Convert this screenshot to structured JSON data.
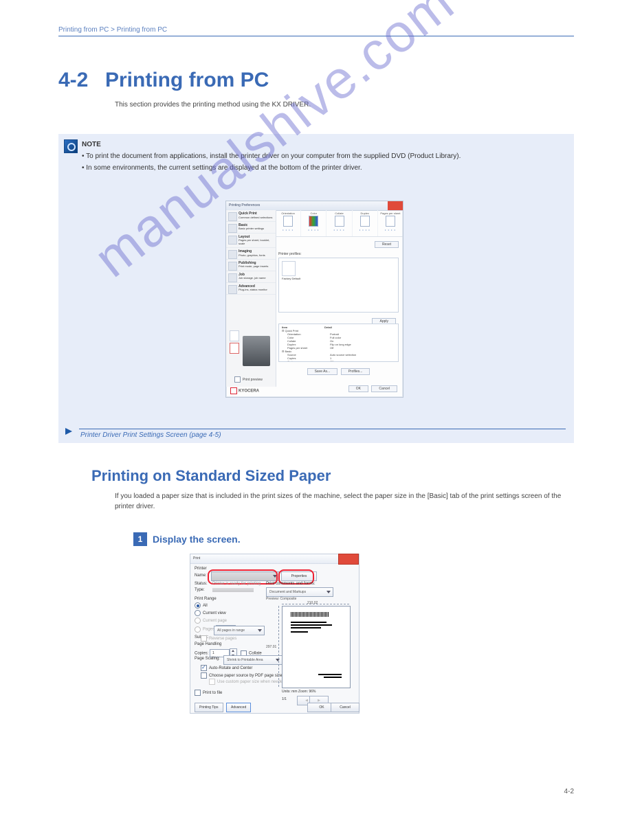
{
  "header": {
    "left": "Printing from PC > Printing from PC",
    "right": ""
  },
  "section": {
    "number": "4-2",
    "title": "Printing from PC"
  },
  "intro": "This section provides the printing method using the KX DRIVER.",
  "note": {
    "heading": "NOTE",
    "lines": [
      "To print the document from applications, install the printer driver on your computer from the supplied DVD (Product Library).",
      "In some environments, the current settings are displayed at the bottom of the printer driver."
    ]
  },
  "ref": "Printer Driver Print Settings Screen (page 4-5)",
  "sub": {
    "title": "Printing on Standard Sized Paper"
  },
  "sub_intro": "If you loaded a paper size that is included in the print sizes of the machine, select the paper size in the [Basic] tab of the print settings screen of the printer driver.",
  "step": {
    "num": "1",
    "title": "Display the screen."
  },
  "shot1": {
    "title": "Printing Preferences",
    "side": [
      {
        "t1": "Quick Print",
        "t2": "Common defined selections"
      },
      {
        "t1": "Basic",
        "t2": "Basic printer settings"
      },
      {
        "t1": "Layout",
        "t2": "Pages per sheet, booklet, scale"
      },
      {
        "t1": "Imaging",
        "t2": "Photo, graphics, fonts"
      },
      {
        "t1": "Publishing",
        "t2": "Print mode, page inserts"
      },
      {
        "t1": "Job",
        "t2": "Job storage, job name"
      },
      {
        "t1": "Advanced",
        "t2": "Plug-ins, status monitor"
      }
    ],
    "tabs": [
      "Orientation",
      "Color",
      "Collate",
      "Duplex",
      "Pages per sheet"
    ],
    "reset": "Reset",
    "profiles_label": "Printer profiles:",
    "profile_name": "Factory Default",
    "apply": "Apply",
    "summary_hdr": {
      "c1": "Item",
      "c2": "Detail"
    },
    "summary": [
      {
        "k": "Quick Print",
        "v": ""
      },
      {
        "k": "Orientation",
        "v": "Portrait"
      },
      {
        "k": "Color",
        "v": "Full color"
      },
      {
        "k": "Collate",
        "v": "On"
      },
      {
        "k": "Duplex",
        "v": "Flip on long edge"
      },
      {
        "k": "Pages per sheet",
        "v": "Off"
      },
      {
        "k": "Basic",
        "v": ""
      },
      {
        "k": "Source",
        "v": "Auto source selection"
      },
      {
        "k": "Copies",
        "v": "1"
      },
      {
        "k": "Carbon copy",
        "v": "Off"
      }
    ],
    "saveas": "Save As...",
    "profiles_btn": "Profiles...",
    "print_preview": "Print preview",
    "brand": "KYOCERA",
    "ok": "OK",
    "cancel": "Cancel"
  },
  "shot2": {
    "title": "Print",
    "printer_group": "Printer",
    "name_label": "Name:",
    "properties": "Properties",
    "status_label": "Status:",
    "status_value": "Printer is ready for printing",
    "type_label": "Type:",
    "comments_label": "Print comments and forms:",
    "comments_value": "Document and Markups",
    "range_heading": "Print Range",
    "all": "All",
    "current_view": "Current view",
    "current_page": "Current page",
    "pages": "Pages",
    "pages_value": "1",
    "subset_label": "Subset:",
    "subset_value": "All pages in range",
    "reverse_pages": "Reverse pages",
    "handling_heading": "Page Handling",
    "copies_label": "Copies:",
    "copies_value": "1",
    "collate": "Collate",
    "scaling_label": "Page Scaling:",
    "scaling_value": "Shrink to Printable Area",
    "autorotate": "Auto-Rotate and Center",
    "choose_paper": "Choose paper source by PDF page size",
    "use_custom": "Use custom paper size when needed",
    "print_to_file": "Print to file",
    "preview_label": "Preview: Composite",
    "preview_w": "210.02",
    "preview_h": "297.01",
    "zoom_label": "Units: mm  Zoom:  96%",
    "pages_indicator": "1/1",
    "tips": "Printing Tips",
    "advanced": "Advanced",
    "ok": "OK",
    "cancel": "Cancel"
  },
  "page_number": "4-2"
}
